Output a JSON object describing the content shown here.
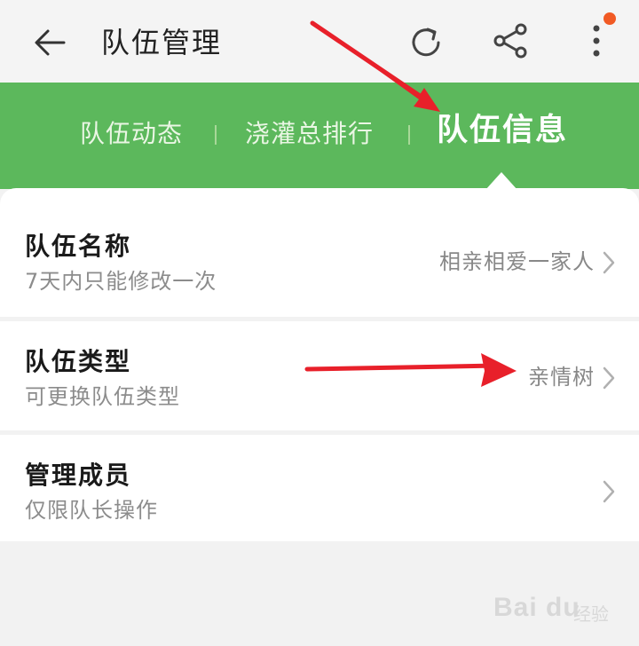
{
  "header": {
    "title": "队伍管理",
    "icons": [
      "back-arrow-icon",
      "refresh-icon",
      "share-icon",
      "more-vertical-icon"
    ],
    "notification_dot_color": "#f15a24"
  },
  "tabs": [
    {
      "label": "队伍动态",
      "active": false
    },
    {
      "label": "浇灌总排行",
      "active": false
    },
    {
      "label": "队伍信息",
      "active": true
    }
  ],
  "colors": {
    "accent_green": "#5cb85c",
    "annotation_red": "#e8202a"
  },
  "rows": [
    {
      "title": "队伍名称",
      "subtitle": "7天内只能修改一次",
      "value": "相亲相爱一家人"
    },
    {
      "title": "队伍类型",
      "subtitle": "可更换队伍类型",
      "value": "亲情树"
    },
    {
      "title": "管理成员",
      "subtitle": "仅限队长操作",
      "value": ""
    }
  ],
  "watermark": {
    "text": "Bai du",
    "suffix": "经验"
  }
}
